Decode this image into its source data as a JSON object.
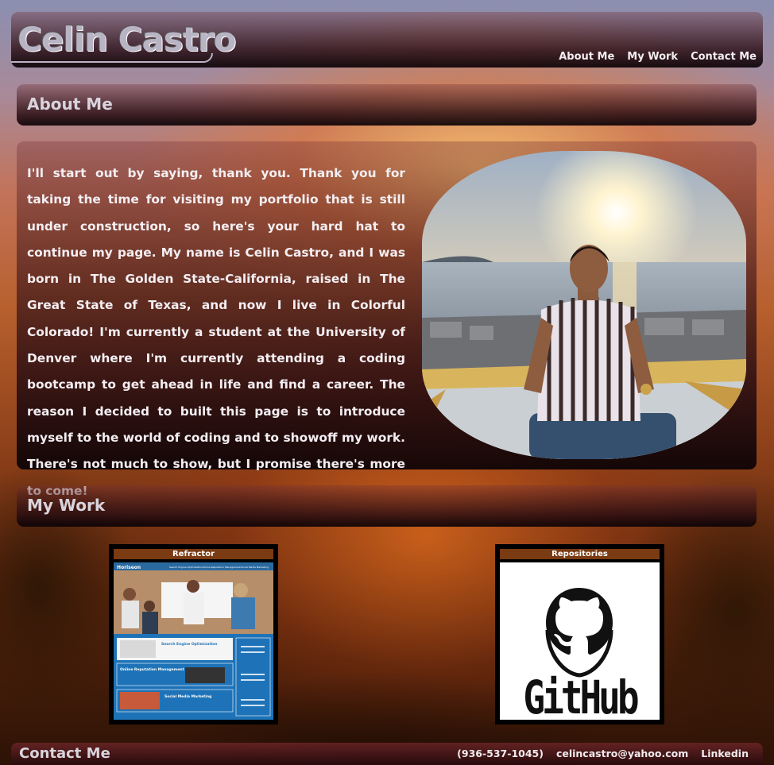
{
  "header": {
    "site_title": "Celin Castro",
    "nav": [
      "About Me",
      "My Work",
      "Contact Me"
    ]
  },
  "about": {
    "heading": "About Me",
    "bio": "I'll start out by saying, thank you. Thank you for taking the time for visiting my portfolio that is still under construction, so here's your hard hat to continue my page. My name is Celin Castro, and I was born in The Golden State-California, raised in The Great State of Texas, and now I live in Colorful Colorado! I'm currently a student at the University of Denver where I'm currently attending a coding bootcamp to get ahead in life and find a career. The reason I decided to built this page is to introduce myself to the world of coding and to showoff my work. There's not much to show, but I promise there's more to come!"
  },
  "work": {
    "heading": "My Work",
    "projects": [
      {
        "label": "Refractor",
        "preview": {
          "brand": "Horiseon",
          "nav": [
            "Search Engine Optimization",
            "Online Reputation Management",
            "Social Media Marketing"
          ],
          "sections": [
            "Search Engine Optimization",
            "Online Reputation Management",
            "Social Media Marketing"
          ]
        }
      },
      {
        "label": "Repositories",
        "logo_text": "GitHub"
      }
    ]
  },
  "footer": {
    "heading": "Contact Me",
    "phone": "(936-537-1045)",
    "email": "celincastro@yahoo.com",
    "linkedin": "Linkedin"
  },
  "colors": {
    "panel_dark": "#140508",
    "label_bar": "#7a3a12",
    "preview_blue": "#1e73b8"
  }
}
